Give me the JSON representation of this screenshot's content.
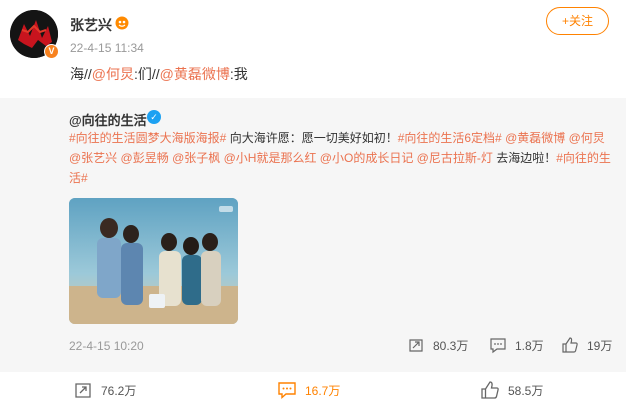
{
  "author": {
    "name": "张艺兴",
    "time": "22-4-15 11:34"
  },
  "follow_label": "+关注",
  "post": {
    "prefix": "海//",
    "mention1": "@何炅",
    "mid": ":们//",
    "mention2": "@黄磊微博",
    "suffix": ":我"
  },
  "repost": {
    "author": "@向往的生活",
    "text_segments": [
      {
        "t": "#向往的生活圆梦大海版海报#",
        "hl": true
      },
      {
        "t": " 向大海许愿：愿一切美好如初！",
        "hl": false
      },
      {
        "t": "#向往的生活6定档#",
        "hl": true
      },
      {
        "t": " ",
        "hl": false
      },
      {
        "t": "@黄磊微博",
        "hl": true
      },
      {
        "t": " ",
        "hl": false
      },
      {
        "t": "@何炅",
        "hl": true
      },
      {
        "t": " ",
        "hl": false
      },
      {
        "t": "@张艺兴",
        "hl": true
      },
      {
        "t": " ",
        "hl": false
      },
      {
        "t": "@彭昱畅",
        "hl": true
      },
      {
        "t": " ",
        "hl": false
      },
      {
        "t": "@张子枫",
        "hl": true
      },
      {
        "t": " ",
        "hl": false
      },
      {
        "t": "@小H就是那么红",
        "hl": true
      },
      {
        "t": " ",
        "hl": false
      },
      {
        "t": "@小O的成长日记",
        "hl": true
      },
      {
        "t": " ",
        "hl": false
      },
      {
        "t": "@尼古拉斯-灯",
        "hl": true
      },
      {
        "t": " 去海边啦！",
        "hl": false
      },
      {
        "t": "#向往的生活#",
        "hl": true
      }
    ],
    "time": "22-4-15 10:20",
    "reposts": "80.3万",
    "comments": "1.8万",
    "likes": "19万"
  },
  "actions": {
    "reposts": "76.2万",
    "comments": "16.7万",
    "likes": "58.5万"
  },
  "colors": {
    "accent": "#ff8200",
    "mention": "#eb7350",
    "repost_bg": "#f6f6f6"
  },
  "icons": [
    "vip-icon",
    "verified-icon",
    "repost-icon",
    "comment-icon",
    "like-icon"
  ]
}
